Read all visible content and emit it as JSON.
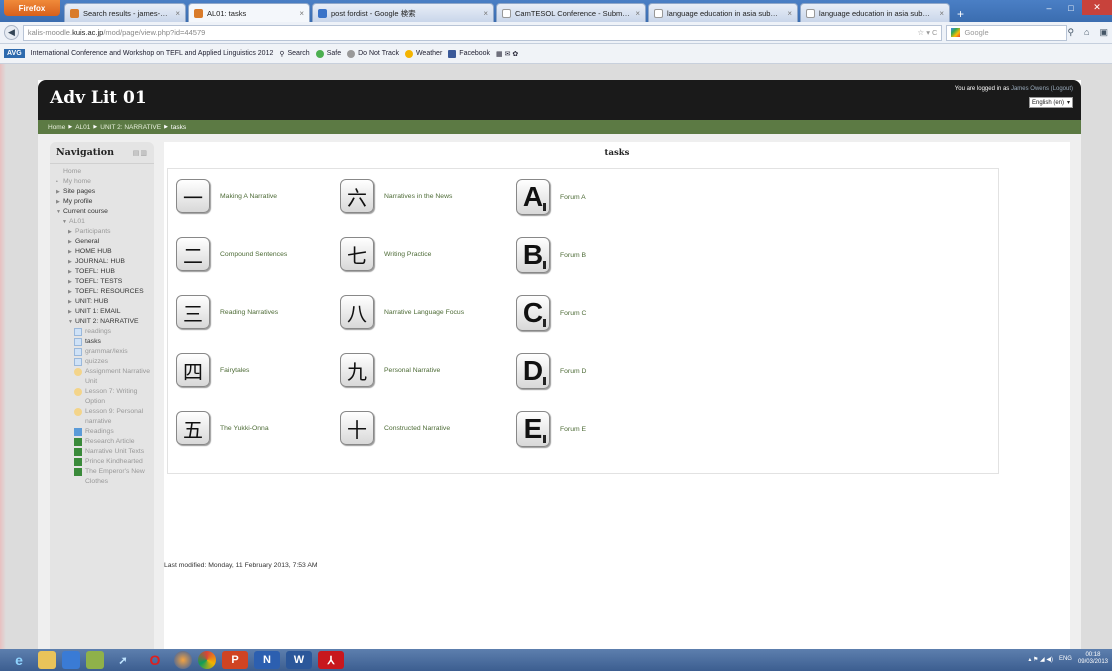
{
  "browser": {
    "menu_button": "Firefox",
    "tabs": [
      {
        "label": "Search results - james-o@kanda.kuis...",
        "icon": "gmail-icon"
      },
      {
        "label": "AL01: tasks",
        "icon": "moodle-icon"
      },
      {
        "label": "post fordist - Google 検索",
        "icon": "google-icon"
      },
      {
        "label": "CamTESOL Conference - Submission ...",
        "icon": "page-icon"
      },
      {
        "label": "language education in asia submissio...",
        "icon": "page-icon"
      },
      {
        "label": "language education in asia submissio...",
        "icon": "page-icon"
      }
    ],
    "new_tab": "+",
    "url_prefix": "kalis-moodle.",
    "url_domain": "kuis.ac.jp",
    "url_path": "/mod/page/view.php?id=44579",
    "search_engine": "Google",
    "toolbar": {
      "avg": "AVG",
      "site_link": "International Conference and Workshop on TEFL and Applied Linguistics 2012",
      "search": "Search",
      "safe": "Safe",
      "dnt": "Do Not Track",
      "weather": "Weather",
      "facebook": "Facebook"
    }
  },
  "site": {
    "title": "Adv Lit 01",
    "logged_in_prefix": "You are logged in as",
    "username": "James Owens (Logout)",
    "language": "English (en)",
    "breadcrumb": [
      "Home",
      "AL01",
      "UNIT 2: NARRATIVE",
      "tasks"
    ]
  },
  "navigation": {
    "title": "Navigation",
    "items": [
      {
        "label": "Home",
        "arrow": "",
        "indent": 0,
        "dim": true
      },
      {
        "label": "My home",
        "arrow": "•",
        "indent": 0,
        "dim": true
      },
      {
        "label": "Site pages",
        "arrow": "▶",
        "indent": 0
      },
      {
        "label": "My profile",
        "arrow": "▶",
        "indent": 0
      },
      {
        "label": "Current course",
        "arrow": "▼",
        "indent": 0
      },
      {
        "label": "AL01",
        "arrow": "▼",
        "indent": 1,
        "dim": true
      },
      {
        "label": "Participants",
        "arrow": "▶",
        "indent": 2,
        "dim": true
      },
      {
        "label": "General",
        "arrow": "▶",
        "indent": 2
      },
      {
        "label": "HOME HUB",
        "arrow": "▶",
        "indent": 2
      },
      {
        "label": "JOURNAL: HUB",
        "arrow": "▶",
        "indent": 2
      },
      {
        "label": "TOEFL: HUB",
        "arrow": "▶",
        "indent": 2
      },
      {
        "label": "TOEFL: TESTS",
        "arrow": "▶",
        "indent": 2
      },
      {
        "label": "TOEFL: RESOURCES",
        "arrow": "▶",
        "indent": 2
      },
      {
        "label": "UNIT: HUB",
        "arrow": "▶",
        "indent": 2
      },
      {
        "label": "UNIT 1: EMAIL",
        "arrow": "▶",
        "indent": 2
      },
      {
        "label": "UNIT 2: NARRATIVE",
        "arrow": "▼",
        "indent": 2
      },
      {
        "label": "readings",
        "icon": "page",
        "indent": 3,
        "dim": true
      },
      {
        "label": "tasks",
        "icon": "page",
        "indent": 3
      },
      {
        "label": "grammar/lexis",
        "icon": "page",
        "indent": 3,
        "dim": true
      },
      {
        "label": "quizzes",
        "icon": "page",
        "indent": 3,
        "dim": true
      },
      {
        "label": "Assignment Narrative Unit",
        "icon": "assign",
        "indent": 3,
        "dim": true
      },
      {
        "label": "Lesson 7: Writing Option",
        "icon": "assign",
        "indent": 3,
        "dim": true
      },
      {
        "label": "Lesson 9: Personal narrative",
        "icon": "assign",
        "indent": 3,
        "dim": true
      },
      {
        "label": "Readings",
        "icon": "folder",
        "indent": 3,
        "dim": true
      },
      {
        "label": "Research Article",
        "icon": "book",
        "indent": 3,
        "dim": true
      },
      {
        "label": "Narrative Unit Texts",
        "icon": "book",
        "indent": 3,
        "dim": true
      },
      {
        "label": "Prince Kindhearted",
        "icon": "book",
        "indent": 3,
        "dim": true
      },
      {
        "label": "The Emperor's New Clothes",
        "icon": "book",
        "indent": 3,
        "dim": true
      }
    ]
  },
  "main": {
    "title": "tasks",
    "columns": [
      [
        {
          "glyph": "一",
          "label": "Making A Narrative"
        },
        {
          "glyph": "二",
          "label": "Compound Sentences"
        },
        {
          "glyph": "三",
          "label": "Reading Narratives"
        },
        {
          "glyph": "四",
          "label": "Fairytales"
        },
        {
          "glyph": "五",
          "label": "The Yukki-Onna"
        }
      ],
      [
        {
          "glyph": "六",
          "label": "Narratives in the News"
        },
        {
          "glyph": "七",
          "label": "Writing Practice"
        },
        {
          "glyph": "八",
          "label": "Narrative Language Focus"
        },
        {
          "glyph": "九",
          "label": "Personal Narrative"
        },
        {
          "glyph": "十",
          "label": "Constructed Narrative"
        }
      ],
      [
        {
          "glyph": "A",
          "label": "Forum A"
        },
        {
          "glyph": "B",
          "label": "Forum B"
        },
        {
          "glyph": "C",
          "label": "Forum C"
        },
        {
          "glyph": "D",
          "label": "Forum D"
        },
        {
          "glyph": "E",
          "label": "Forum E"
        }
      ]
    ],
    "last_modified": "Last modified: Monday, 11 February 2013, 7:53 AM"
  },
  "taskbar": {
    "lang": "ENG",
    "time": "00:18",
    "date": "09/03/2013"
  }
}
